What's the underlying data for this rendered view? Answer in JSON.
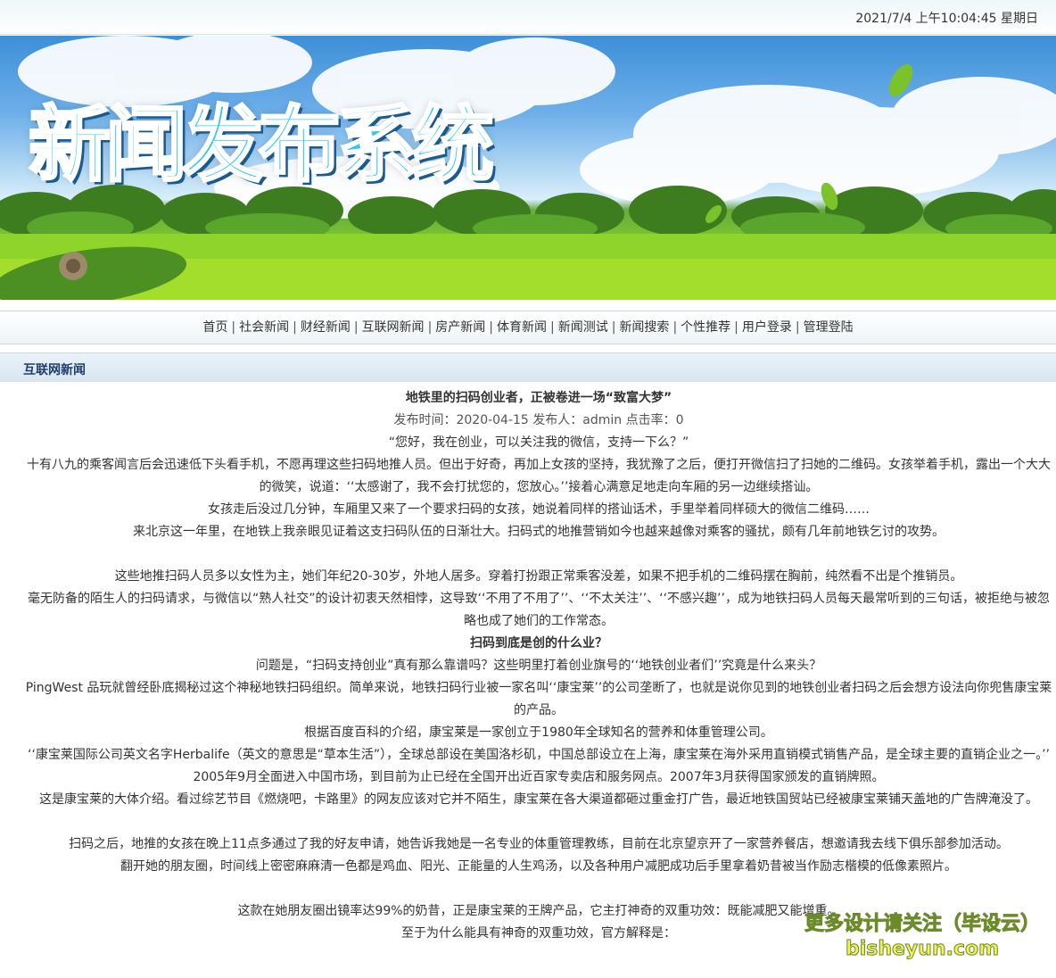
{
  "header": {
    "datetime": "2021/7/4 上午10:04:45  星期日"
  },
  "banner": {
    "title": "新闻发布系统"
  },
  "nav": {
    "items": [
      "首页",
      "社会新闻",
      "财经新闻",
      "互联网新闻",
      "房产新闻",
      "体育新闻",
      "新闻测试",
      "新闻搜索",
      "个性推荐",
      "用户登录",
      "管理登陆"
    ],
    "separator": "|"
  },
  "section": {
    "title": "互联网新闻"
  },
  "article": {
    "title": "地铁里的扫码创业者，正被卷进一场“致富大梦”",
    "meta": "发布时间：2020-04-15 发布人：admin 点击率：0",
    "paragraphs": [
      "“您好，我在创业，可以关注我的微信，支持一下么？”",
      "十有八九的乘客闻言后会迅速低下头看手机，不愿再理这些扫码地推人员。但出于好奇，再加上女孩的坚持，我犹豫了之后，便打开微信扫了扫她的二维码。女孩举着手机，露出一个大大的微笑，说道：‘‘太感谢了，我不会打扰您的，您放心。’’接着心满意足地走向车厢的另一边继续搭讪。",
      "女孩走后没过几分钟，车厢里又来了一个要求扫码的女孩，她说着同样的搭讪话术，手里举着同样硕大的微信二维码……",
      "来北京这一年里，在地铁上我亲眼见证着这支扫码队伍的日渐壮大。扫码式的地推营销如今也越来越像对乘客的骚扰，颇有几年前地铁乞讨的攻势。",
      "",
      "这些地推扫码人员多以女性为主，她们年纪20-30岁，外地人居多。穿着打扮跟正常乘客没差，如果不把手机的二维码摆在胸前，纯然看不出是个推销员。",
      "毫无防备的陌生人的扫码请求，与微信以“熟人社交”的设计初衷天然相悖，这导致‘‘不用了不用了’’、‘‘不太关注’’、‘‘不感兴趣’’，成为地铁扫码人员每天最常听到的三句话，被拒绝与被忽略也成了她们的工作常态。",
      "扫码到底是创的什么业？",
      "问题是，“扫码支持创业”真有那么靠谱吗？这些明里打着创业旗号的‘‘地铁创业者们’’究竟是什么来头？",
      "PingWest 品玩就曾经卧底揭秘过这个神秘地铁扫码组织。简单来说，地铁扫码行业被一家名叫‘‘康宝莱’’的公司垄断了，也就是说你见到的地铁创业者扫码之后会想方设法向你兜售康宝莱的产品。",
      "根据百度百科的介绍，康宝莱是一家创立于1980年全球知名的营养和体重管理公司。",
      "‘‘康宝莱国际公司英文名字Herbalife（英文的意思是“草本生活”），全球总部设在美国洛杉矶，中国总部设立在上海，康宝莱在海外采用直销模式销售产品，是全球主要的直销企业之一。’’",
      "2005年9月全面进入中国市场，到目前为止已经在全国开出近百家专卖店和服务网点。2007年3月获得国家颁发的直销牌照。",
      "这是康宝莱的大体介绍。看过综艺节目《燃烧吧，卡路里》的网友应该对它并不陌生，康宝莱在各大渠道都砸过重金打广告，最近地铁国贸站已经被康宝莱铺天盖地的广告牌淹没了。",
      "",
      "扫码之后，地推的女孩在晚上11点多通过了我的好友申请，她告诉我她是一名专业的体重管理教练，目前在北京望京开了一家营养餐店，想邀请我去线下俱乐部参加活动。",
      "翻开她的朋友圈，时间线上密密麻麻清一色都是鸡血、阳光、正能量的人生鸡汤，以及各种用户减肥成功后手里拿着奶昔被当作励志楷模的低像素照片。",
      "",
      "这款在她朋友圈出镜率达99%的奶昔，正是康宝莱的王牌产品，它主打神奇的双重功效：既能减肥又能增重。",
      "至于为什么能具有神奇的双重功效，官方解释是："
    ]
  },
  "watermark": {
    "line1": "更多设计请关注（毕设云）",
    "line2": "bisheyun.com"
  },
  "colors": {
    "nav_border": "#c9d9e3",
    "section_title": "#1e3c6e",
    "banner_title": "#33c8e8"
  }
}
